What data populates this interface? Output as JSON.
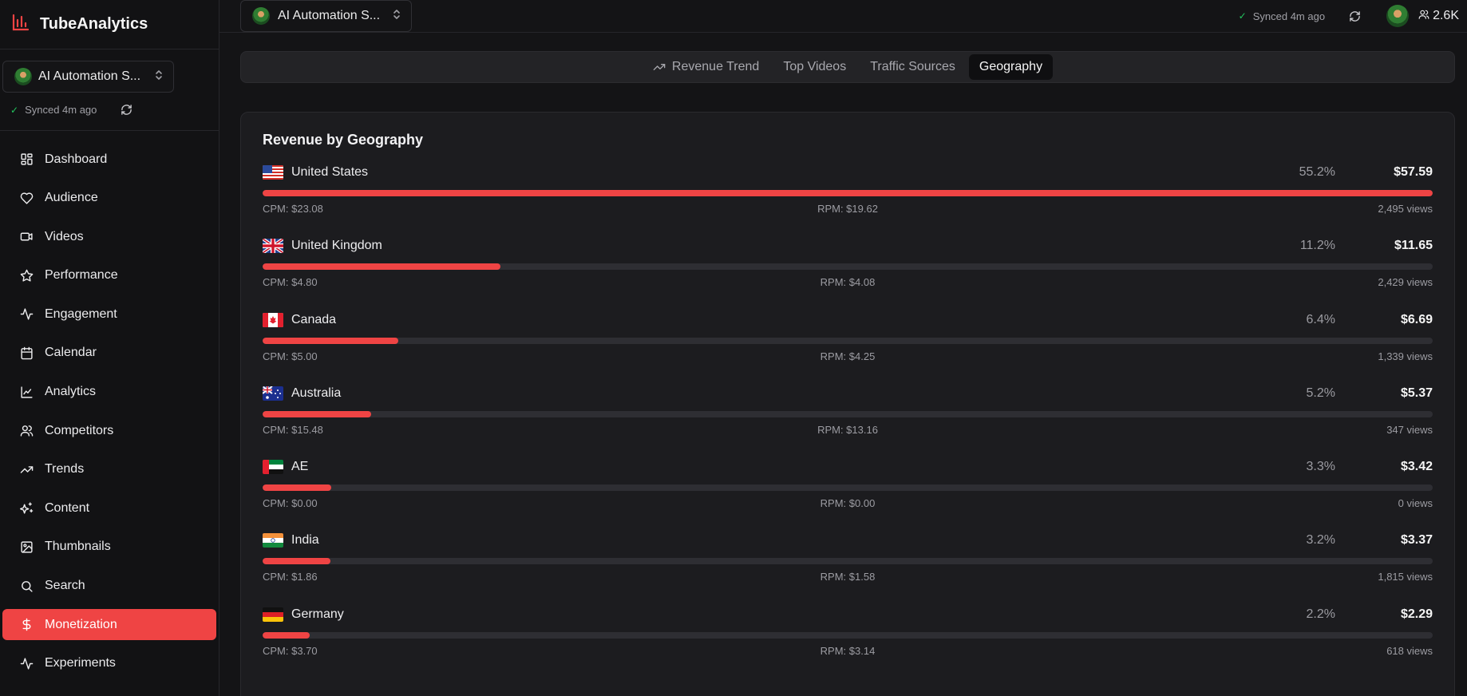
{
  "brand": {
    "name": "TubeAnalytics"
  },
  "channel": {
    "name": "AI Automation S...",
    "sync_text": "Synced 4m ago"
  },
  "topbar": {
    "sync_text": "Synced 4m ago",
    "subscribers": "2.6K"
  },
  "nav": [
    {
      "label": "Dashboard",
      "icon": "dashboard-icon"
    },
    {
      "label": "Audience",
      "icon": "heart-icon"
    },
    {
      "label": "Videos",
      "icon": "video-icon"
    },
    {
      "label": "Performance",
      "icon": "star-icon"
    },
    {
      "label": "Engagement",
      "icon": "activity-icon"
    },
    {
      "label": "Calendar",
      "icon": "calendar-icon"
    },
    {
      "label": "Analytics",
      "icon": "line-chart-icon"
    },
    {
      "label": "Competitors",
      "icon": "users-icon"
    },
    {
      "label": "Trends",
      "icon": "trending-up-icon"
    },
    {
      "label": "Content",
      "icon": "sparkles-icon"
    },
    {
      "label": "Thumbnails",
      "icon": "image-icon"
    },
    {
      "label": "Search",
      "icon": "search-icon"
    },
    {
      "label": "Monetization",
      "icon": "dollar-icon",
      "active": true
    },
    {
      "label": "Experiments",
      "icon": "activity-icon"
    }
  ],
  "tabs": [
    {
      "label": "Revenue Trend",
      "icon": "trending-up-icon"
    },
    {
      "label": "Top Videos"
    },
    {
      "label": "Traffic Sources"
    },
    {
      "label": "Geography",
      "active": true
    }
  ],
  "geography": {
    "title": "Revenue by Geography",
    "rows": [
      {
        "country": "United States",
        "flag": "us",
        "percent": "55.2%",
        "share": 1.0,
        "revenue": "$57.59",
        "cpm": "CPM: $23.08",
        "rpm": "RPM: $19.62",
        "views": "2,495 views"
      },
      {
        "country": "United Kingdom",
        "flag": "gb",
        "percent": "11.2%",
        "share": 0.203,
        "revenue": "$11.65",
        "cpm": "CPM: $4.80",
        "rpm": "RPM: $4.08",
        "views": "2,429 views"
      },
      {
        "country": "Canada",
        "flag": "ca",
        "percent": "6.4%",
        "share": 0.116,
        "revenue": "$6.69",
        "cpm": "CPM: $5.00",
        "rpm": "RPM: $4.25",
        "views": "1,339 views"
      },
      {
        "country": "Australia",
        "flag": "au",
        "percent": "5.2%",
        "share": 0.093,
        "revenue": "$5.37",
        "cpm": "CPM: $15.48",
        "rpm": "RPM: $13.16",
        "views": "347 views"
      },
      {
        "country": "AE",
        "flag": "ae",
        "percent": "3.3%",
        "share": 0.059,
        "revenue": "$3.42",
        "cpm": "CPM: $0.00",
        "rpm": "RPM: $0.00",
        "views": "0 views"
      },
      {
        "country": "India",
        "flag": "in",
        "percent": "3.2%",
        "share": 0.058,
        "revenue": "$3.37",
        "cpm": "CPM: $1.86",
        "rpm": "RPM: $1.58",
        "views": "1,815 views"
      },
      {
        "country": "Germany",
        "flag": "de",
        "percent": "2.2%",
        "share": 0.04,
        "revenue": "$2.29",
        "cpm": "CPM: $3.70",
        "rpm": "RPM: $3.14",
        "views": "618 views"
      }
    ]
  },
  "colors": {
    "accent": "#ef4444",
    "background": "#141416",
    "card": "#1c1c1f",
    "success": "#22c55e"
  }
}
